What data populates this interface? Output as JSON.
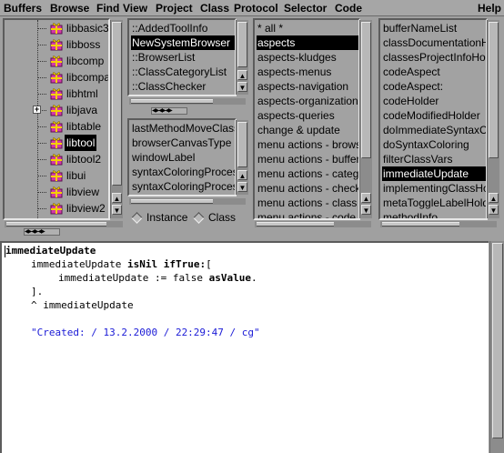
{
  "menubar": {
    "items": [
      "Buffers",
      "Browse",
      "Find",
      "View",
      "Project",
      "Class",
      "Protocol",
      "Selector",
      "Code"
    ],
    "help": "Help"
  },
  "tree": {
    "items": [
      {
        "label": "libbasic3",
        "selected": false,
        "expandable": false
      },
      {
        "label": "libboss",
        "selected": false,
        "expandable": false
      },
      {
        "label": "libcomp",
        "selected": false,
        "expandable": false
      },
      {
        "label": "libcompa",
        "selected": false,
        "expandable": false
      },
      {
        "label": "libhtml",
        "selected": false,
        "expandable": false
      },
      {
        "label": "libjava",
        "selected": false,
        "expandable": true
      },
      {
        "label": "libtable",
        "selected": false,
        "expandable": false
      },
      {
        "label": "libtool",
        "selected": true,
        "expandable": false
      },
      {
        "label": "libtool2",
        "selected": false,
        "expandable": false
      },
      {
        "label": "libui",
        "selected": false,
        "expandable": false
      },
      {
        "label": "libview",
        "selected": false,
        "expandable": false
      },
      {
        "label": "libview2",
        "selected": false,
        "expandable": false
      }
    ]
  },
  "classes": {
    "items": [
      {
        "label": "::AddedToolInfo",
        "selected": false
      },
      {
        "label": "NewSystemBrowser",
        "selected": true
      },
      {
        "label": "::BrowserList",
        "selected": false
      },
      {
        "label": "::ClassCategoryList",
        "selected": false
      },
      {
        "label": "::ClassChecker",
        "selected": false
      }
    ]
  },
  "variables": {
    "items": [
      "lastMethodMoveClass",
      "browserCanvasType",
      "windowLabel",
      "syntaxColoringProcess",
      "syntaxColoringProcessRunning"
    ]
  },
  "radios": {
    "instance": "Instance",
    "class": "Class"
  },
  "protocols": {
    "items": [
      {
        "label": "* all *",
        "selected": false
      },
      {
        "label": "aspects",
        "selected": true
      },
      {
        "label": "aspects-kludges",
        "selected": false
      },
      {
        "label": "aspects-menus",
        "selected": false
      },
      {
        "label": "aspects-navigation",
        "selected": false
      },
      {
        "label": "aspects-organization",
        "selected": false
      },
      {
        "label": "aspects-queries",
        "selected": false
      },
      {
        "label": "change & update",
        "selected": false
      },
      {
        "label": "menu actions - browse",
        "selected": false
      },
      {
        "label": "menu actions - buffers",
        "selected": false
      },
      {
        "label": "menu actions - category",
        "selected": false
      },
      {
        "label": "menu actions - checks",
        "selected": false
      },
      {
        "label": "menu actions - class",
        "selected": false
      },
      {
        "label": "menu actions - code",
        "selected": false
      }
    ]
  },
  "selectors": {
    "items": [
      {
        "label": "bufferNameList",
        "selected": false
      },
      {
        "label": "classDocumentationHolder",
        "selected": false
      },
      {
        "label": "classesProjectInfoHolder",
        "selected": false
      },
      {
        "label": "codeAspect",
        "selected": false
      },
      {
        "label": "codeAspect:",
        "selected": false
      },
      {
        "label": "codeHolder",
        "selected": false
      },
      {
        "label": "codeModifiedHolder",
        "selected": false
      },
      {
        "label": "doImmediateSyntaxColoring",
        "selected": false
      },
      {
        "label": "doSyntaxColoring",
        "selected": false
      },
      {
        "label": "filterClassVars",
        "selected": false
      },
      {
        "label": "immediateUpdate",
        "selected": true
      },
      {
        "label": "implementingClassHolder",
        "selected": false
      },
      {
        "label": "metaToggleLabelHolder",
        "selected": false
      },
      {
        "label": "methodInfo",
        "selected": false
      }
    ]
  },
  "code": {
    "line1": "immediateUpdate",
    "line2_a": "immediateUpdate ",
    "line2_b": "isNil ifTrue:",
    "line2_c": "[",
    "line3_a": "immediateUpdate := false ",
    "line3_b": "asValue",
    "line3_c": ".",
    "line4": "].",
    "line5": "^ immediateUpdate",
    "comment": "\"Created: / 13.2.2000 / 22:29:47 / cg\""
  },
  "colors": {
    "selection": "#000000",
    "comment": "#1a1ad6",
    "panel": "#a2a2a2"
  }
}
